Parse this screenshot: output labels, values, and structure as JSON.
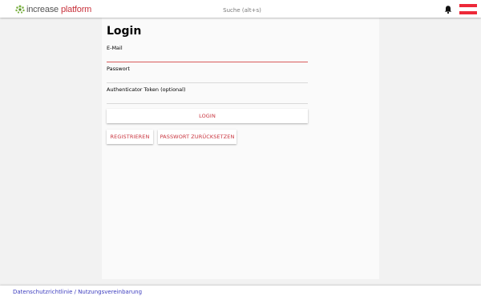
{
  "header": {
    "logo": {
      "word1": "increase",
      "word2": "platform",
      "accent_color": "#c8323c",
      "leaf_color": "#7bb241"
    },
    "search": {
      "placeholder": "Suche (alt+s)",
      "value": ""
    },
    "notifications_icon": "bell-icon",
    "language_icon": "austria-flag-icon",
    "flag_colors": [
      "#ed2939",
      "#ffffff",
      "#ed2939"
    ]
  },
  "login": {
    "title": "Login",
    "email": {
      "label": "E-Mail",
      "value": ""
    },
    "password": {
      "label": "Passwort",
      "value": ""
    },
    "token": {
      "label": "Authenticator Token (optional)",
      "value": ""
    },
    "login_button": "LOGIN",
    "register_button": "REGISTRIEREN",
    "reset_button": "PASSWORT ZURÜCKSETZEN"
  },
  "footer": {
    "link": "Datenschutzrichtlinie / Nutzungsvereinbarung",
    "link_color": "#3d3dbf"
  }
}
